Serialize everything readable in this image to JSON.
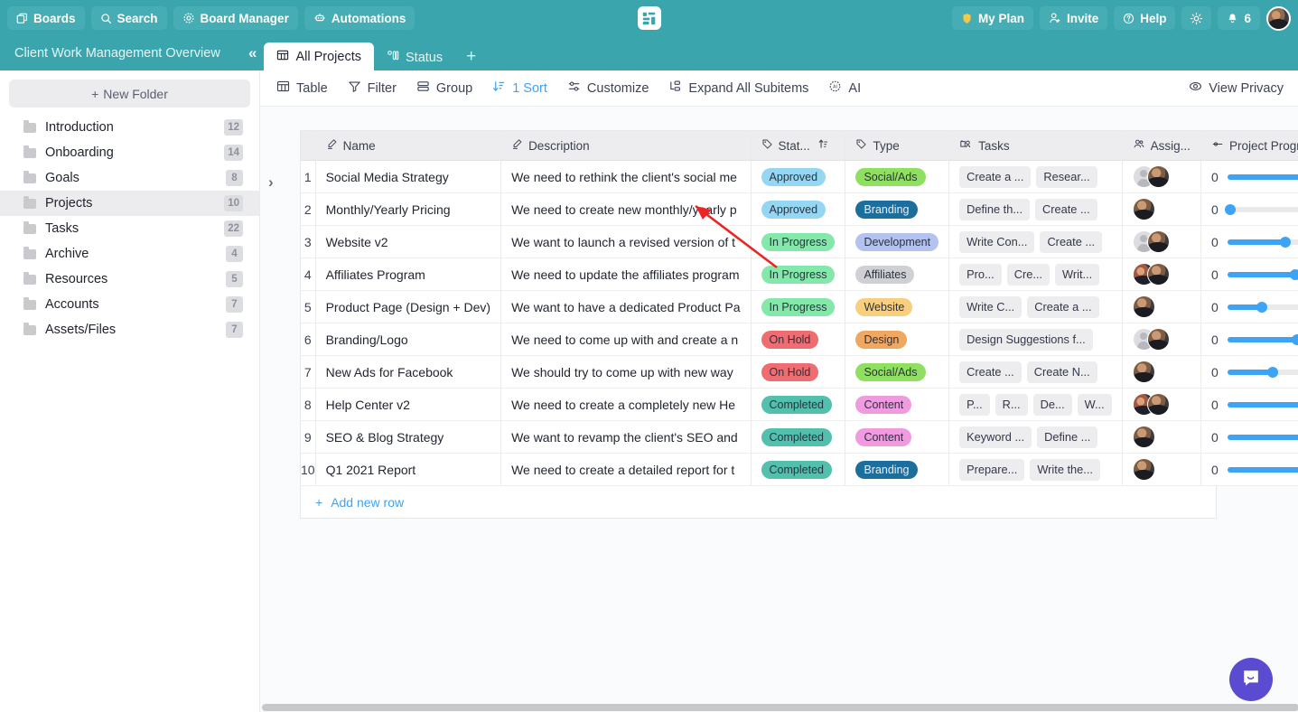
{
  "topbar": {
    "left_buttons": [
      {
        "label": "Boards",
        "icon": "boards-icon"
      },
      {
        "label": "Search",
        "icon": "search-icon"
      },
      {
        "label": "Board Manager",
        "icon": "gear-icon"
      },
      {
        "label": "Automations",
        "icon": "robot-icon"
      }
    ],
    "right_buttons": [
      {
        "label": "My Plan",
        "icon": "shield-icon"
      },
      {
        "label": "Invite",
        "icon": "user-add-icon"
      },
      {
        "label": "Help",
        "icon": "question-circle-icon"
      }
    ],
    "theme_toggle_icon": "sun-icon",
    "notifications_icon": "bell-icon",
    "notifications_count": "6",
    "avatar_name": "user-avatar"
  },
  "boardbar": {
    "title": "Client Work Management Overview",
    "collapse_label": "«",
    "tabs": [
      {
        "label": "All Projects",
        "icon": "table-icon",
        "active": true
      },
      {
        "label": "Status",
        "icon": "kanban-icon",
        "active": false
      }
    ],
    "add_tab_label": "+"
  },
  "sidebar": {
    "new_folder_label": "New Folder",
    "new_folder_plus": "+",
    "items": [
      {
        "label": "Introduction",
        "count": "12",
        "selected": false
      },
      {
        "label": "Onboarding",
        "count": "14",
        "selected": false
      },
      {
        "label": "Goals",
        "count": "8",
        "selected": false
      },
      {
        "label": "Projects",
        "count": "10",
        "selected": true
      },
      {
        "label": "Tasks",
        "count": "22",
        "selected": false
      },
      {
        "label": "Archive",
        "count": "4",
        "selected": false
      },
      {
        "label": "Resources",
        "count": "5",
        "selected": false
      },
      {
        "label": "Accounts",
        "count": "7",
        "selected": false
      },
      {
        "label": "Assets/Files",
        "count": "7",
        "selected": false
      }
    ]
  },
  "toolbar": {
    "items": [
      {
        "label": "Table",
        "icon": "table-icon",
        "accent": false
      },
      {
        "label": "Filter",
        "icon": "funnel-icon",
        "accent": false
      },
      {
        "label": "Group",
        "icon": "group-icon",
        "accent": false
      },
      {
        "label": "1 Sort",
        "icon": "sort-icon",
        "accent": true
      },
      {
        "label": "Customize",
        "icon": "sliders-icon",
        "accent": false
      },
      {
        "label": "Expand All Subitems",
        "icon": "expand-icon",
        "accent": false
      },
      {
        "label": "AI",
        "icon": "ai-icon",
        "accent": false
      }
    ],
    "view_privacy_label": "View Privacy",
    "view_privacy_icon": "eye-icon"
  },
  "table": {
    "columns": [
      {
        "label": "",
        "icon": "",
        "key": "idx",
        "cls": "col-idx"
      },
      {
        "label": "Name",
        "icon": "pencil-icon",
        "key": "name",
        "cls": "col-name"
      },
      {
        "label": "Description",
        "icon": "pencil-icon",
        "key": "desc",
        "cls": "col-desc"
      },
      {
        "label": "Stat...",
        "icon": "tag-icon",
        "key": "status",
        "cls": "col-status",
        "sorted": true,
        "sort_icon": "sort-asc-icon"
      },
      {
        "label": "Type",
        "icon": "tag-icon",
        "key": "type",
        "cls": "col-type"
      },
      {
        "label": "Tasks",
        "icon": "link-items-icon",
        "key": "tasks",
        "cls": "col-tasks"
      },
      {
        "label": "Assig...",
        "icon": "people-icon",
        "key": "assignees",
        "cls": "col-assign"
      },
      {
        "label": "Project Progress",
        "icon": "slider-icon",
        "key": "progress",
        "cls": "col-prog"
      }
    ],
    "rows": [
      {
        "idx": "1",
        "name": "Social Media Strategy",
        "desc": "We need to rethink the client's social me",
        "status": "Approved",
        "status_color": "#95d7f2",
        "status_dark": false,
        "type": "Social/Ads",
        "type_color": "#8fe061",
        "type_dark": false,
        "tasks": [
          "Create a ...",
          "Resear..."
        ],
        "avatars": [
          "ghost",
          "person"
        ],
        "progress_value": "0",
        "progress_pct": 98
      },
      {
        "idx": "2",
        "name": "Monthly/Yearly Pricing",
        "desc": "We need to create new monthly/yearly p",
        "status": "Approved",
        "status_color": "#95d7f2",
        "status_dark": false,
        "type": "Branding",
        "type_color": "#1c6f9c",
        "type_dark": true,
        "tasks": [
          "Define th...",
          "Create ..."
        ],
        "avatars": [
          "person"
        ],
        "progress_value": "0",
        "progress_pct": 3
      },
      {
        "idx": "3",
        "name": "Website v2",
        "desc": "We want to launch a revised version of t",
        "status": "In Progress",
        "status_color": "#85e8ab",
        "status_dark": false,
        "type": "Development",
        "type_color": "#b3c2ee",
        "type_dark": false,
        "tasks": [
          "Write Con...",
          "Create ..."
        ],
        "avatars": [
          "ghost",
          "person"
        ],
        "progress_value": "0",
        "progress_pct": 63
      },
      {
        "idx": "4",
        "name": "Affiliates Program",
        "desc": "We need to update the affiliates program",
        "status": "In Progress",
        "status_color": "#85e8ab",
        "status_dark": false,
        "type": "Affiliates",
        "type_color": "#cfd0d3",
        "type_dark": false,
        "tasks": [
          "Pro...",
          "Cre...",
          "Writ..."
        ],
        "avatars": [
          "person2",
          "person"
        ],
        "progress_value": "0",
        "progress_pct": 74
      },
      {
        "idx": "5",
        "name": "Product Page (Design + Dev)",
        "desc": "We want to have a dedicated Product Pa",
        "status": "In Progress",
        "status_color": "#85e8ab",
        "status_dark": false,
        "type": "Website",
        "type_color": "#f7cf7f",
        "type_dark": false,
        "tasks": [
          "Write C...",
          "Create a ..."
        ],
        "avatars": [
          "person"
        ],
        "progress_value": "0",
        "progress_pct": 37
      },
      {
        "idx": "6",
        "name": "Branding/Logo",
        "desc": "We need to come up with and create a n",
        "status": "On Hold",
        "status_color": "#ef6d70",
        "status_dark": false,
        "type": "Design",
        "type_color": "#f0a761",
        "type_dark": false,
        "tasks": [
          "Design Suggestions f..."
        ],
        "avatars": [
          "ghost",
          "person"
        ],
        "progress_value": "0",
        "progress_pct": 76
      },
      {
        "idx": "7",
        "name": "New Ads for Facebook",
        "desc": "We should try to come up with new way",
        "status": "On Hold",
        "status_color": "#ef6d70",
        "status_dark": false,
        "type": "Social/Ads",
        "type_color": "#8fe061",
        "type_dark": false,
        "tasks": [
          "Create ...",
          "Create N..."
        ],
        "avatars": [
          "person"
        ],
        "progress_value": "0",
        "progress_pct": 49
      },
      {
        "idx": "8",
        "name": "Help Center v2",
        "desc": "We need to create a completely new He",
        "status": "Completed",
        "status_color": "#53c0ae",
        "status_dark": false,
        "type": "Content",
        "type_color": "#f09ae0",
        "type_dark": false,
        "tasks": [
          "P...",
          "R...",
          "De...",
          "W..."
        ],
        "avatars": [
          "person2",
          "person"
        ],
        "progress_value": "0",
        "progress_pct": 100
      },
      {
        "idx": "9",
        "name": "SEO & Blog Strategy",
        "desc": "We want to revamp the client's SEO and",
        "status": "Completed",
        "status_color": "#53c0ae",
        "status_dark": false,
        "type": "Content",
        "type_color": "#f09ae0",
        "type_dark": false,
        "tasks": [
          "Keyword ...",
          "Define ..."
        ],
        "avatars": [
          "person"
        ],
        "progress_value": "0",
        "progress_pct": 100
      },
      {
        "idx": "10",
        "name": "Q1 2021 Report",
        "desc": "We need to create a detailed report for t",
        "status": "Completed",
        "status_color": "#53c0ae",
        "status_dark": false,
        "type": "Branding",
        "type_color": "#1c6f9c",
        "type_dark": true,
        "tasks": [
          "Prepare...",
          "Write the..."
        ],
        "avatars": [
          "person"
        ],
        "progress_value": "0",
        "progress_pct": 100
      }
    ],
    "add_row_label": "Add new row",
    "add_row_plus": "+"
  },
  "chat": {
    "icon": "chat-bubble-icon"
  },
  "colors": {
    "brand_teal": "#3aa5ad",
    "accent_blue": "#3da3f5",
    "annotation_red": "#ec2424",
    "chat_purple": "#5a4bd1"
  }
}
